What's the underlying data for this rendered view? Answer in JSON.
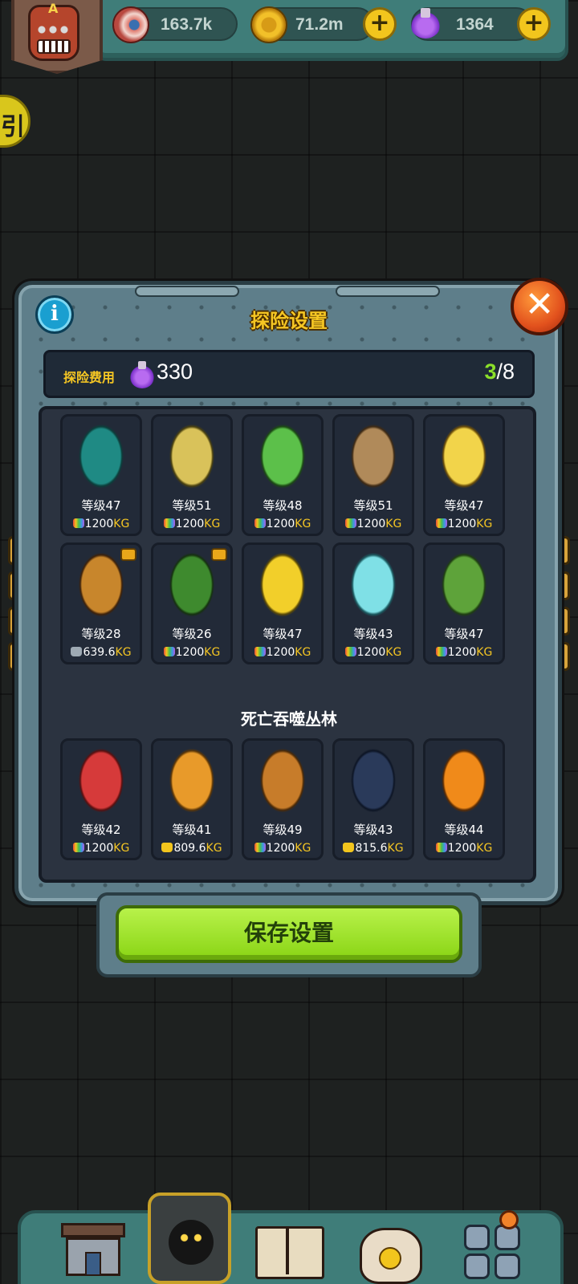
{
  "topbar": {
    "avatar_letter": "A",
    "currencies": [
      {
        "icon": "eyeball-icon",
        "amount": "163.7k"
      },
      {
        "icon": "coin-icon",
        "amount": "71.2m"
      },
      {
        "icon": "potion-icon",
        "amount": "1364"
      }
    ]
  },
  "side_tab_glyph": "引",
  "dialog": {
    "title": "探险设置",
    "info_glyph": "i",
    "close_glyph": "✕",
    "cost_label": "探险费用",
    "cost_value": "330",
    "team_current": "3",
    "team_total": "/8",
    "section_title": "死亡吞噬丛林",
    "save_label": "保存设置"
  },
  "monsters": [
    {
      "name": "two-headed-bird",
      "level": "等级47",
      "capacity_value": "1200",
      "unit": "KG",
      "bag": "rainbow",
      "badge": false
    },
    {
      "name": "wheat-creature",
      "level": "等级51",
      "capacity_value": "1200",
      "unit": "KG",
      "bag": "rainbow",
      "badge": false
    },
    {
      "name": "lettuce-creature",
      "level": "等级48",
      "capacity_value": "1200",
      "unit": "KG",
      "bag": "rainbow",
      "badge": false
    },
    {
      "name": "burlap-sack-creature",
      "level": "等级51",
      "capacity_value": "1200",
      "unit": "KG",
      "bag": "rainbow",
      "badge": false
    },
    {
      "name": "chick-creature",
      "level": "等级47",
      "capacity_value": "1200",
      "unit": "KG",
      "bag": "rainbow",
      "badge": false
    },
    {
      "name": "horned-yak",
      "level": "等级28",
      "capacity_value": "639.6",
      "unit": "KG",
      "bag": "gray",
      "badge": true
    },
    {
      "name": "broccoli-tree",
      "level": "等级26",
      "capacity_value": "1200",
      "unit": "KG",
      "bag": "rainbow",
      "badge": true
    },
    {
      "name": "corn-creature",
      "level": "等级47",
      "capacity_value": "1200",
      "unit": "KG",
      "bag": "rainbow",
      "badge": false
    },
    {
      "name": "radish-ghost",
      "level": "等级43",
      "capacity_value": "1200",
      "unit": "KG",
      "bag": "rainbow",
      "badge": false
    },
    {
      "name": "leaf-sprout",
      "level": "等级47",
      "capacity_value": "1200",
      "unit": "KG",
      "bag": "rainbow",
      "badge": false
    },
    {
      "name": "tomato-toad",
      "level": "等级42",
      "capacity_value": "1200",
      "unit": "KG",
      "bag": "rainbow",
      "badge": false
    },
    {
      "name": "mushroom-goat",
      "level": "等级41",
      "capacity_value": "809.6",
      "unit": "KG",
      "bag": "gold",
      "badge": false
    },
    {
      "name": "potato-ape",
      "level": "等级49",
      "capacity_value": "1200",
      "unit": "KG",
      "bag": "rainbow",
      "badge": false
    },
    {
      "name": "chainsaw-pig",
      "level": "等级43",
      "capacity_value": "815.6",
      "unit": "KG",
      "bag": "gold",
      "badge": false
    },
    {
      "name": "pumpkin-head",
      "level": "等级44",
      "capacity_value": "1200",
      "unit": "KG",
      "bag": "rainbow",
      "badge": false
    }
  ],
  "bottom_nav": [
    "shop-icon",
    "expedition-icon",
    "monster-book-icon",
    "loot-bag-icon",
    "inventory-grid-icon"
  ],
  "colors": {
    "accent_gold": "#f5c623",
    "save_green": "#89d414",
    "team_green": "#8be02a",
    "frame_teal": "#3f7d79"
  }
}
